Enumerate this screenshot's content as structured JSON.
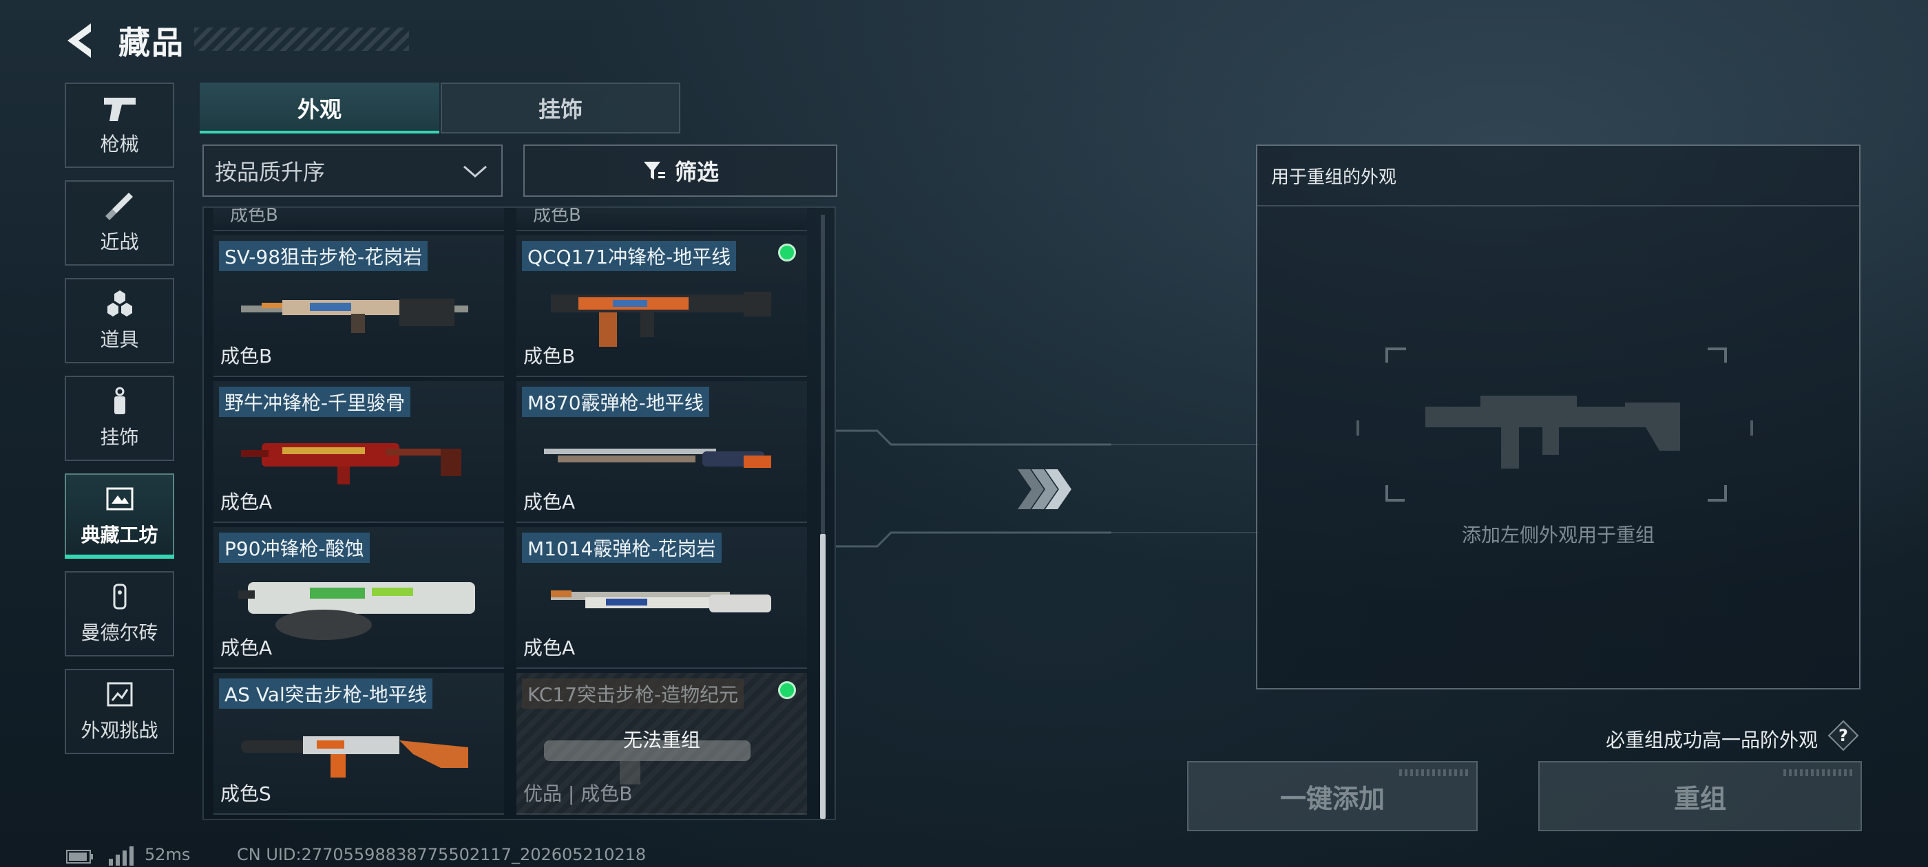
{
  "header": {
    "title": "藏品"
  },
  "nav": {
    "items": [
      {
        "label": "枪械",
        "icon": "pistol-icon"
      },
      {
        "label": "近战",
        "icon": "knife-icon"
      },
      {
        "label": "道具",
        "icon": "hexagons-icon"
      },
      {
        "label": "挂饰",
        "icon": "keychain-icon"
      },
      {
        "label": "典藏工坊",
        "icon": "workshop-icon",
        "active": true
      },
      {
        "label": "曼德尔砖",
        "icon": "brick-icon"
      },
      {
        "label": "外观挑战",
        "icon": "challenge-icon"
      }
    ]
  },
  "tabs": [
    {
      "label": "外观",
      "active": true
    },
    {
      "label": "挂饰",
      "active": false
    }
  ],
  "sort": {
    "value": "按品质升序"
  },
  "filter": {
    "label": "筛选"
  },
  "list": {
    "cut_row": [
      "成色B",
      "成色B"
    ],
    "items": [
      {
        "name": "SV-98狙击步枪-花岗岩",
        "grade": "成色B",
        "equipped": false,
        "disabled": false
      },
      {
        "name": "QCQ171冲锋枪-地平线",
        "grade": "成色B",
        "equipped": true,
        "disabled": false
      },
      {
        "name": "野牛冲锋枪-千里骏骨",
        "grade": "成色A",
        "equipped": false,
        "disabled": false
      },
      {
        "name": "M870霰弹枪-地平线",
        "grade": "成色A",
        "equipped": false,
        "disabled": false
      },
      {
        "name": "P90冲锋枪-酸蚀",
        "grade": "成色A",
        "equipped": false,
        "disabled": false
      },
      {
        "name": "M1014霰弹枪-花岗岩",
        "grade": "成色A",
        "equipped": false,
        "disabled": false
      },
      {
        "name": "AS Val突击步枪-地平线",
        "grade": "成色S",
        "equipped": false,
        "disabled": false
      },
      {
        "name": "KC17突击步枪-造物纪元",
        "grade": "优品 | 成色B",
        "equipped": true,
        "disabled": true,
        "overlay": "无法重组"
      }
    ]
  },
  "recombine": {
    "header": "用于重组的外观",
    "placeholder": "添加左侧外观用于重组",
    "guarantee": "必重组成功高一品阶外观",
    "help_symbol": "?",
    "add_all_label": "一键添加",
    "recombine_label": "重组"
  },
  "status": {
    "latency": "52ms",
    "uid": "CN UID:27705598838775502117_202605210218"
  },
  "colors": {
    "accent": "#37d6b2",
    "equipped_dot": "#1ed86a",
    "name_tag": "#2d5878"
  }
}
